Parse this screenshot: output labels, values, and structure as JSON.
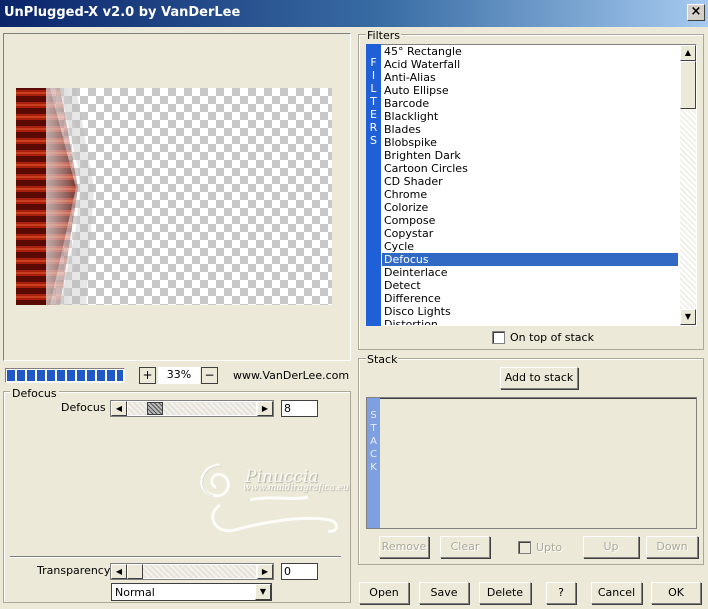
{
  "window": {
    "title": "UnPlugged-X v2.0 by VanDerLee",
    "close_label": "×"
  },
  "preview": {
    "zoom_in_label": "+",
    "zoom_out_label": "−",
    "zoom": "33%",
    "website": "www.VanDerLee.com",
    "progress": 1.0
  },
  "parameters": {
    "group_title": "Defocus",
    "defocus": {
      "label": "Defocus",
      "value": "8"
    },
    "transparency": {
      "label": "Transparency",
      "value": "0"
    },
    "blend_mode": "Normal"
  },
  "filters": {
    "group_title": "Filters",
    "sidebar_text": [
      "F",
      "I",
      "L",
      "T",
      "E",
      "R",
      "S"
    ],
    "items": [
      "45° Rectangle",
      "Acid Waterfall",
      "Anti-Alias",
      "Auto Ellipse",
      "Barcode",
      "Blacklight",
      "Blades",
      "Blobspike",
      "Brighten Dark",
      "Cartoon Circles",
      "CD Shader",
      "Chrome",
      "Colorize",
      "Compose",
      "Copystar",
      "Cycle",
      "Defocus",
      "Deinterlace",
      "Detect",
      "Difference",
      "Disco Lights",
      "Distortion"
    ],
    "selected": "Defocus",
    "on_top_label": "On top of stack"
  },
  "stack": {
    "group_title": "Stack",
    "add_label": "Add to stack",
    "sidebar_text": [
      "S",
      "T",
      "A",
      "C",
      "K"
    ],
    "remove_label": "Remove",
    "clear_label": "Clear",
    "upto_label": "Upto",
    "up_label": "Up",
    "down_label": "Down"
  },
  "buttons": {
    "open": "Open",
    "save": "Save",
    "delete": "Delete",
    "help": "?",
    "cancel": "Cancel",
    "ok": "OK"
  },
  "watermark": {
    "name": "Pinuccia",
    "site": "www.maidiragrafica.eu"
  },
  "colors": {
    "selection": "#316ac5",
    "filters_sidebar": "#1f60d8",
    "stack_sidebar": "#7ea0e0",
    "progress": "#2058c8"
  }
}
